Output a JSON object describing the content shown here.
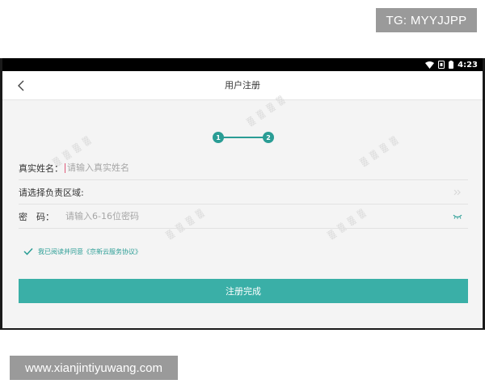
{
  "overlay": {
    "tg_label": "TG: MYYJJPP",
    "site_label": "www.xianjintiyuwang.com"
  },
  "statusbar": {
    "time": "4:23",
    "icons": [
      "wifi-icon",
      "sim-signal-icon",
      "battery-icon"
    ]
  },
  "appbar": {
    "back_icon": "chevron-left-icon",
    "title": "用户注册"
  },
  "stepper": {
    "steps": [
      "1",
      "2"
    ],
    "color": "#2a9d95"
  },
  "form": {
    "name": {
      "label": "真实姓名：",
      "placeholder": "请输入真实姓名"
    },
    "region": {
      "label": "请选择负责区域:",
      "end_icon": "double-chevron-right-icon"
    },
    "password": {
      "label": "密　码：",
      "placeholder": "请输入6-16位密码",
      "end_icon": "eye-closed-icon"
    }
  },
  "agreement": {
    "checked": true,
    "text": "我已阅读并同意《京新云服务协议》"
  },
  "submit": {
    "label": "注册完成",
    "color": "#3aafa7"
  }
}
